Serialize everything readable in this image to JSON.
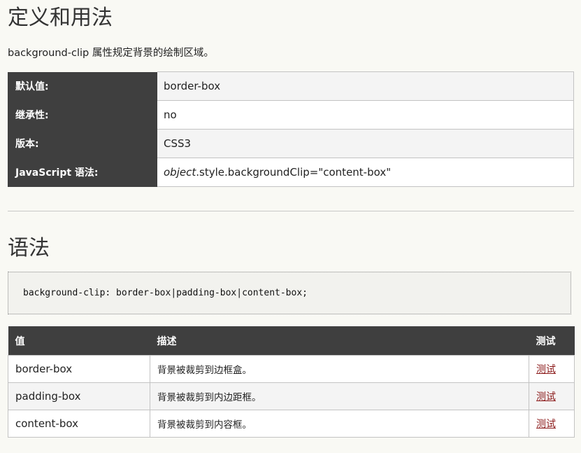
{
  "definition": {
    "heading": "定义和用法",
    "description": "background-clip 属性规定背景的绘制区域。",
    "properties": [
      {
        "label": "默认值:",
        "value": "border-box"
      },
      {
        "label": "继承性:",
        "value": "no"
      },
      {
        "label": "版本:",
        "value": "CSS3"
      },
      {
        "label": "JavaScript 语法:",
        "value_italic": "object",
        "value": ".style.backgroundClip=\"content-box\""
      }
    ]
  },
  "syntax": {
    "heading": "语法",
    "code": "background-clip: border-box|padding-box|content-box;"
  },
  "values_table": {
    "headers": {
      "value": "值",
      "description": "描述",
      "test": "测试"
    },
    "rows": [
      {
        "value": "border-box",
        "description": "背景被裁剪到边框盒。",
        "test": "测试"
      },
      {
        "value": "padding-box",
        "description": "背景被裁剪到内边距框。",
        "test": "测试"
      },
      {
        "value": "content-box",
        "description": "背景被裁剪到内容框。",
        "test": "测试"
      }
    ]
  },
  "colors": {
    "header_bg": "#3f3f3f",
    "link": "#8b1a1a",
    "page_bg": "#f9f9f4"
  }
}
